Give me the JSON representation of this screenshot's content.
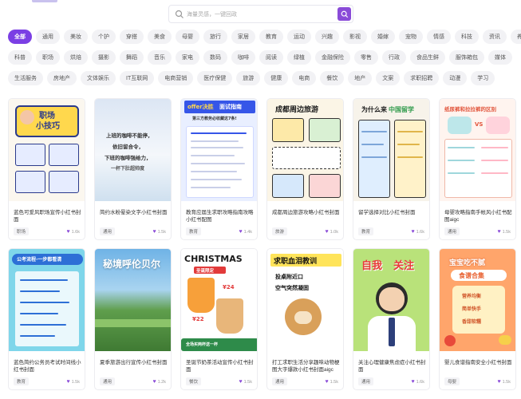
{
  "search": {
    "placeholder": "海量灵感，一键回政"
  },
  "categories": {
    "row1": [
      "全部",
      "通用",
      "美妆",
      "个护",
      "穿搭",
      "美食",
      "母婴",
      "旅行",
      "家居",
      "教育",
      "运动",
      "兴趣",
      "影视",
      "婚嫁",
      "宠物",
      "情感",
      "科技",
      "资讯",
      "养生"
    ],
    "row2": [
      "科普",
      "职场",
      "烘焙",
      "摄影",
      "舞蹈",
      "音乐",
      "家电",
      "数码",
      "咖啡",
      "阅读",
      "绿植",
      "金融保险",
      "零售",
      "行政",
      "食品生鲜",
      "服饰箱包",
      "媒体"
    ],
    "row3": [
      "生活服务",
      "房地产",
      "文体娱乐",
      "IT互联网",
      "电商营销",
      "医疗保健",
      "旅游",
      "健康",
      "电商",
      "餐饮",
      "地产",
      "文案",
      "求职招聘",
      "动漫",
      "学习"
    ],
    "active": "全部"
  },
  "cards": [
    {
      "title": "蓝色可爱风职场宣传小红书封面",
      "tag": "职场",
      "likes": "1.6k",
      "thumb": [
        "职场",
        "小技巧"
      ]
    },
    {
      "title": "简约水粉晕染文字小红书封面",
      "tag": "通用",
      "likes": "1.5k",
      "thumb": [
        "上班的咖啡不能停，",
        "依旧留合令，",
        "下班的咖啡强给力，",
        "一杯下肚超帅度"
      ]
    },
    {
      "title": "教育应届生求职攻略指南攻略小红书配图",
      "tag": "教育",
      "likes": "1.4k",
      "thumb": [
        "offer决胜",
        "面试指南",
        "第三方教务必收藏这7条!"
      ]
    },
    {
      "title": "成都周边旅游攻略小红书封面",
      "tag": "旅游",
      "likes": "1.0k",
      "thumb": [
        "成都周边旅游"
      ]
    },
    {
      "title": "留学选择对比小红书封面",
      "tag": "教育",
      "likes": "1.6k",
      "thumb": [
        "为什么来",
        "中国留学"
      ]
    },
    {
      "title": "母婴攻略指南手帐风小红书配图aigc",
      "tag": "通用",
      "likes": "1.5k",
      "thumb": [
        "纸尿裤和拉拉裤的区别",
        "VS"
      ]
    },
    {
      "title": "蓝色简约公务员考试时间线小红书封面",
      "tag": "教育",
      "likes": "1.5k",
      "thumb": [
        "公考流程·一步都看清"
      ]
    },
    {
      "title": "夏季旅游出行宣传小红书封面",
      "tag": "通用",
      "likes": "1.2k",
      "thumb": [
        "秘境呼伦贝尔"
      ]
    },
    {
      "title": "圣诞节奶茶活动宣传小红书封面",
      "tag": "餐饮",
      "likes": "1.5k",
      "thumb": [
        "CHRISTMAS",
        "圣诞限定",
        "¥24",
        "¥22",
        "全场买两杯送一杯"
      ]
    },
    {
      "title": "打工求职生活分享趣味动物梗图大字爆款小红书封面aigc",
      "tag": "通用",
      "likes": "1.5k",
      "thumb": [
        "求职血泪教训",
        "投桌附近口",
        "空气突然凝固"
      ]
    },
    {
      "title": "关注心理健康焦虑症小红书封面",
      "tag": "通用",
      "likes": "1.6k",
      "thumb": [
        "自我",
        "关注"
      ]
    },
    {
      "title": "婴儿食谱指南安全小红书封面",
      "tag": "母婴",
      "likes": "1.5k",
      "thumb": [
        "宝宝吃不腻",
        "食谱合集",
        "营养均衡",
        "简单快手",
        "香甜软糯"
      ]
    }
  ],
  "colors": {
    "accent": "#7b3fe4"
  }
}
